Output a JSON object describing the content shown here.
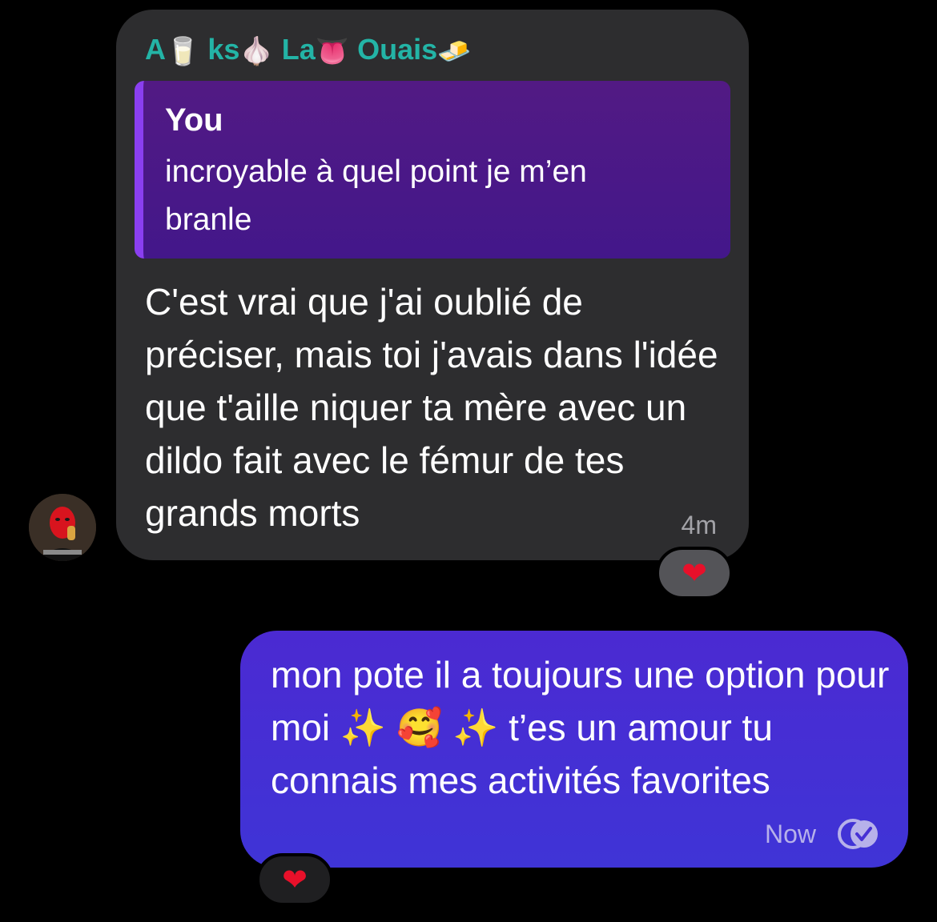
{
  "incoming": {
    "sender_parts": [
      "A",
      "🥛",
      " ks",
      "🧄",
      " La",
      "👅",
      " Ouais",
      "🧈"
    ],
    "reply": {
      "author": "You",
      "text": "incroyable à quel point je m’en branle"
    },
    "text": "C'est vrai que j'ai oublié de préciser, mais toi j'avais dans l'idée que t'aille niquer ta mère avec un dildo fait avec le fémur de tes grands morts",
    "time": "4m",
    "reaction": "❤"
  },
  "outgoing": {
    "text": "mon pote il a toujours une option pour moi ✨ 🥰 ✨ t’es un amour tu connais mes activités favorites",
    "time": "Now",
    "reaction": "❤",
    "receipt_icon": "double-check-icon"
  },
  "colors": {
    "sender_name": "#23b4a6",
    "incoming_bubble": "#2d2d2f",
    "reply_bg": "#4a178a",
    "reply_accent": "#8a3ff0",
    "outgoing_bubble": "#4630d4",
    "heart": "#e8102a"
  }
}
